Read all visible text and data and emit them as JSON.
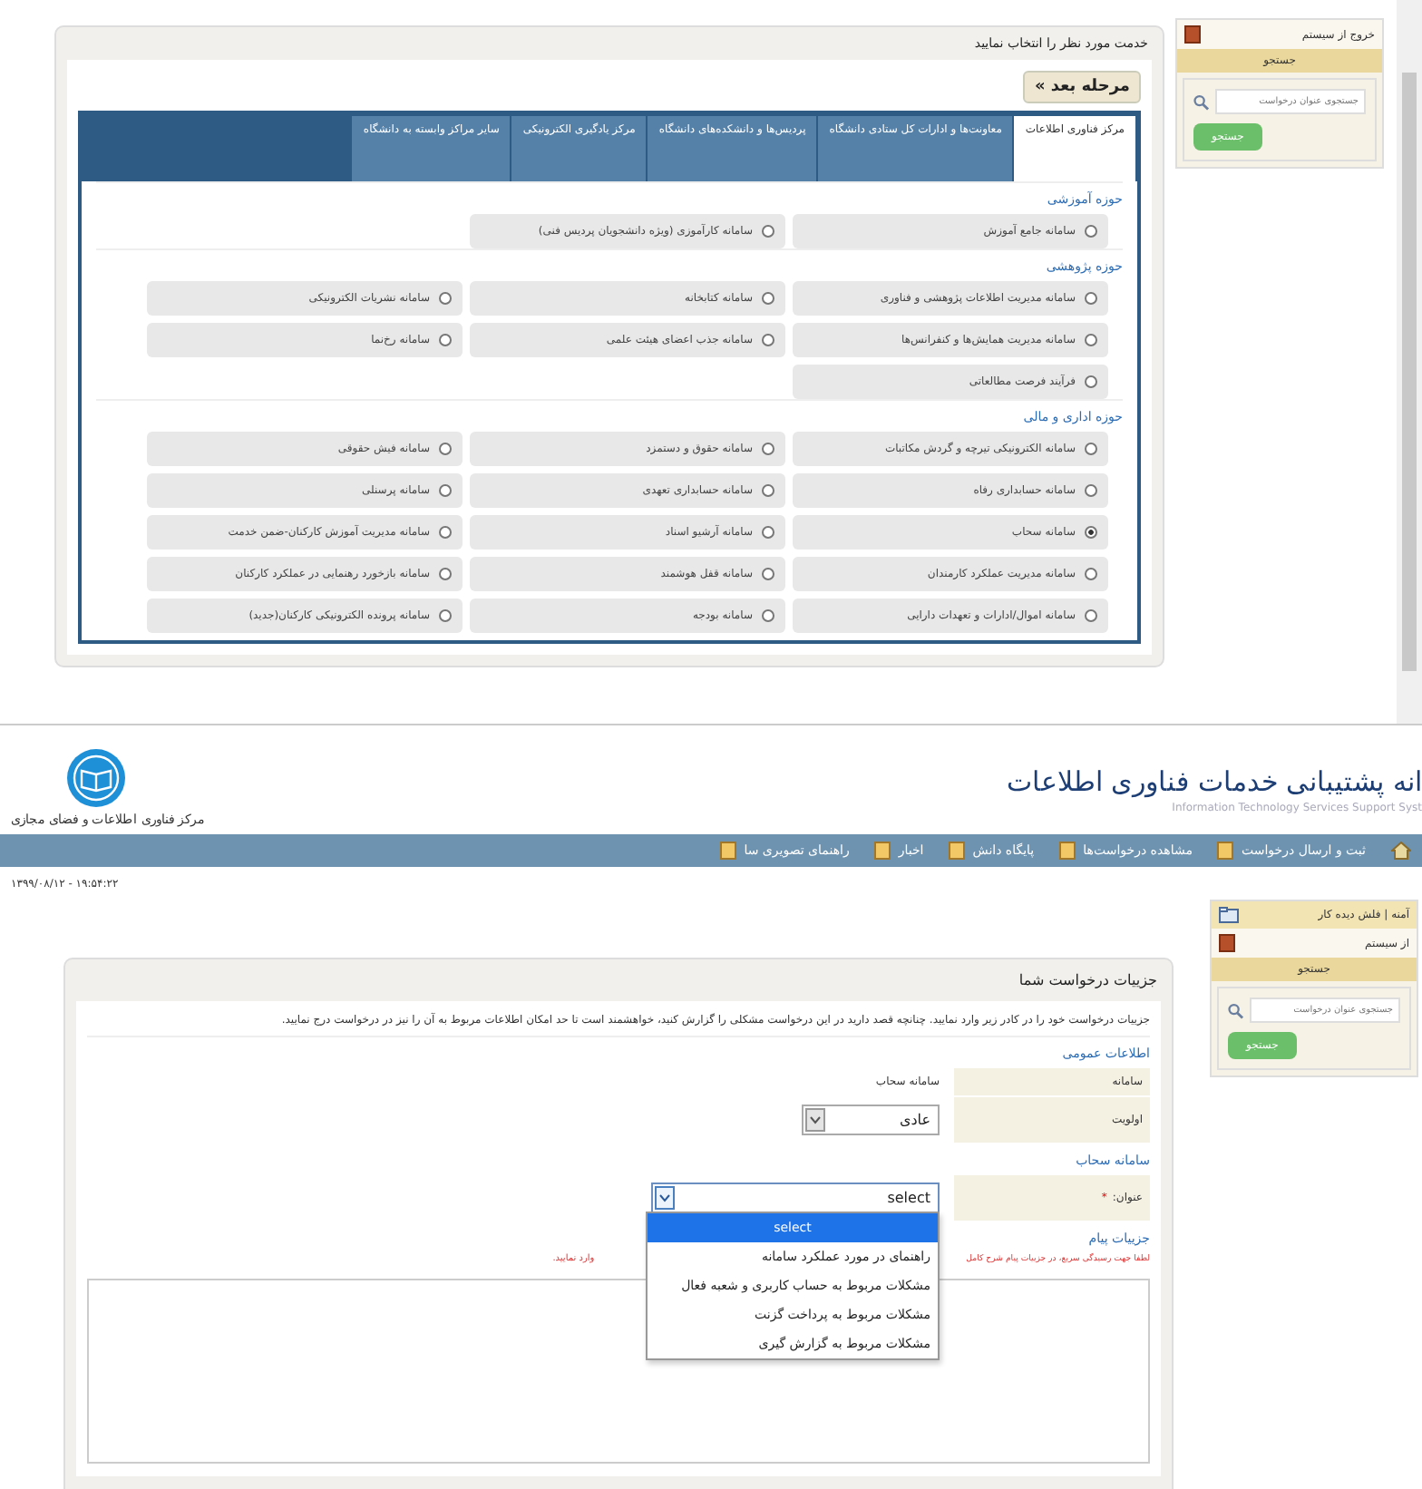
{
  "service_panel": {
    "title": "خدمت مورد نظر را انتخاب نمایید",
    "next_button": "مرحله بعد »",
    "tabs": [
      {
        "label": "مرکز فناوری اطلاعات",
        "selected": true
      },
      {
        "label": "معاونت‌ها و ادارات کل ستادی دانشگاه",
        "selected": false
      },
      {
        "label": "پردیس‌ها و دانشکده‌های دانشگاه",
        "selected": false
      },
      {
        "label": "مرکز یادگیری الکترونیکی",
        "selected": false
      },
      {
        "label": "سایر مراکز وابسته به دانشگاه",
        "selected": false
      }
    ],
    "sections": [
      {
        "title": "حوزه آموزشی",
        "options": [
          {
            "label": "سامانه جامع آموزش",
            "selected": false
          },
          {
            "label": "سامانه کارآموزی (ویژه دانشجویان پردیس فنی)",
            "selected": false
          }
        ]
      },
      {
        "title": "حوزه پژوهشی",
        "options": [
          {
            "label": "سامانه مدیریت اطلاعات پژوهشی و فناوری",
            "selected": false
          },
          {
            "label": "سامانه کتابخانه",
            "selected": false
          },
          {
            "label": "سامانه نشریات الکترونیکی",
            "selected": false
          },
          {
            "label": "سامانه مدیریت همایش‌ها و کنفرانس‌ها",
            "selected": false
          },
          {
            "label": "سامانه جذب اعضای هیئت علمی",
            "selected": false
          },
          {
            "label": "سامانه رخ‌نما",
            "selected": false
          },
          {
            "label": "فرآیند فرصت مطالعاتی",
            "selected": false
          }
        ]
      },
      {
        "title": "حوزه اداری و مالی",
        "options": [
          {
            "label": "سامانه الکترونیکی تیرچه و گردش مکاتبات",
            "selected": false
          },
          {
            "label": "سامانه حقوق و دستمزد",
            "selected": false
          },
          {
            "label": "سامانه فیش حقوقی",
            "selected": false
          },
          {
            "label": "سامانه حسابداری رفاه",
            "selected": false
          },
          {
            "label": "سامانه حسابداری تعهدی",
            "selected": false
          },
          {
            "label": "سامانه پرسنلی",
            "selected": false
          },
          {
            "label": "سامانه سحاب",
            "selected": true
          },
          {
            "label": "سامانه آرشیو اسناد",
            "selected": false
          },
          {
            "label": "سامانه مدیریت آموزش کارکنان-ضمن خدمت",
            "selected": false
          },
          {
            "label": "سامانه مدیریت عملکرد کارمندان",
            "selected": false
          },
          {
            "label": "سامانه قفل هوشمند",
            "selected": false
          },
          {
            "label": "سامانه بازخورد رهنمایی در عملکرد کارکنان",
            "selected": false
          },
          {
            "label": "سامانه اموال/ادارات و تعهدات دارایی",
            "selected": false
          },
          {
            "label": "سامانه بودجه",
            "selected": false
          },
          {
            "label": "سامانه پرونده الکترونیکی کارکنان(جدید)",
            "selected": false
          }
        ]
      }
    ]
  },
  "top_sidebar": {
    "logout": "خروج از سیستم",
    "search_title": "جستجو",
    "search": {
      "placeholder": "جستجوی عنوان درخواست"
    },
    "search_button": "جستجو"
  },
  "header": {
    "site_title": "انه پشتیبانی خدمات فناوری اطلاعات",
    "site_subtitle": "Information Technology Services Support Syst",
    "center_name": "مرکز فناوری اطلاعات و فضای مجازی"
  },
  "nav": [
    "ثبت و ارسال درخواست",
    "مشاهده درخواست‌ها",
    "پایگاه دانش",
    "اخبار",
    "راهنمای تصویری سا"
  ],
  "datetime": "۱۳۹۹/۰۸/۱۲ - ۱۹:۵۴:۲۲",
  "bottom_sidebar": {
    "user": "آمنه | فلش دیده کار",
    "logout": "از سیستم",
    "search_title": "جستجو",
    "search": {
      "placeholder": "جستجوی عنوان درخواست"
    },
    "search_button": "جستجو"
  },
  "request_panel": {
    "title": "جزییات درخواست شما",
    "intro": "جزییات درخواست خود را در کادر زیر وارد نمایید. چنانچه قصد دارید در این درخواست مشکلی را گزارش کنید، خواهشمند است تا حد امکان اطلاعات مربوط به آن را نیز در درخواست درج نمایید.",
    "general": {
      "title": "اطلاعات عمومی",
      "system_label": "سامانه",
      "system_value": "سامانه سحاب",
      "priority_label": "اولویت",
      "priority_value": "عادی"
    },
    "system_section": {
      "title": "سامانه سحاب",
      "subject_label": "عنوان:",
      "required_mark": "*",
      "subject_value": "select",
      "options": [
        {
          "label": "select",
          "selected": true
        },
        {
          "label": "راهنمای در مورد عملکرد سامانه",
          "selected": false
        },
        {
          "label": "مشکلات مربوط به حساب کاربری و شعبه فعال",
          "selected": false
        },
        {
          "label": "مشکلات مربوط به پرداخت گزنت",
          "selected": false
        },
        {
          "label": "مشکلات مربوط به گزارش گیری",
          "selected": false
        }
      ]
    },
    "message": {
      "title": "جزییات پیام",
      "hint_start": "لطفا جهت رسیدگی سریع، در جزییات پیام شرح کامل",
      "hint_end": "وارد نمایید."
    }
  }
}
